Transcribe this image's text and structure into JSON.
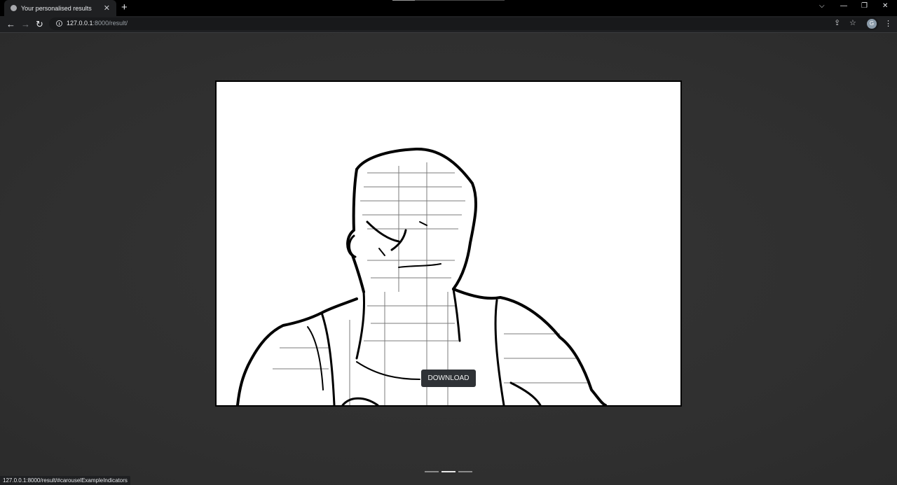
{
  "tab": {
    "title": "Your personalised results",
    "close_glyph": "✕",
    "favicon": "globe-icon"
  },
  "new_tab_glyph": "+",
  "window_controls": {
    "dropdown": "⌵",
    "minimize": "—",
    "restore": "❐",
    "close": "✕"
  },
  "nav": {
    "back": "←",
    "forward": "→",
    "reload": "↻"
  },
  "address": {
    "host": "127.0.0.1",
    "path": ":8000/result/"
  },
  "toolbar_icons": {
    "share": "⇪",
    "star": "☆",
    "profile_initial": "G",
    "menu": "⋮"
  },
  "main": {
    "download_label": "DOWNLOAD",
    "image": "sketch of person (edge-detection output)",
    "carousel_count": 3,
    "carousel_active": 1
  },
  "status_url": "127.0.0.1:8000/result/#carouselExampleIndicators",
  "colors": {
    "background": "#333333",
    "frame": "#000000",
    "button": "#2f3236"
  }
}
